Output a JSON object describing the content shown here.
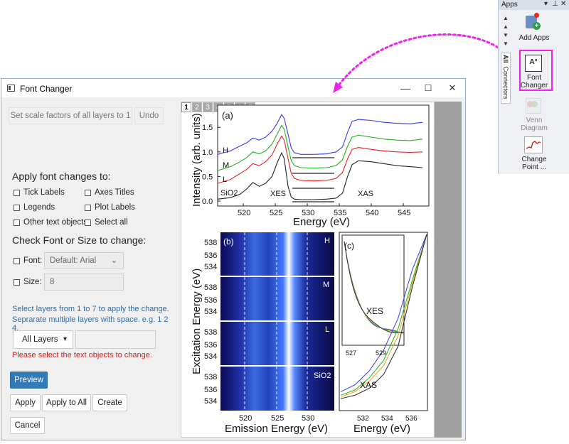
{
  "window": {
    "title": "Font Changer",
    "minimize": "—",
    "maximize": "☐",
    "close": "✕"
  },
  "top_buttons": {
    "scale": "Set scale factors of all layers to 1",
    "undo": "Undo"
  },
  "apply_section": {
    "heading": "Apply font changes to:",
    "options": [
      {
        "label": "Tick Labels",
        "checked": false
      },
      {
        "label": "Axes Titles",
        "checked": false
      },
      {
        "label": "Legends",
        "checked": false
      },
      {
        "label": "Plot Labels",
        "checked": false
      },
      {
        "label": "Other text objects",
        "checked": false
      },
      {
        "label": "Select all",
        "checked": false
      }
    ]
  },
  "check_section": {
    "heading": "Check Font or Size to change:",
    "font_label": "Font:",
    "font_value": "Default: Arial",
    "size_label": "Size:",
    "size_value": "8"
  },
  "layers_info": {
    "line1": "Select layers from 1 to 7 to apply the change.",
    "line2": "Seprarate multiple layers with space. e.g. 1 2 4."
  },
  "layer_select": {
    "value": "All Layers",
    "input_value": ""
  },
  "error_text": "Please select the text objects to change.",
  "buttons": {
    "preview": "Preview",
    "apply": "Apply",
    "apply_all": "Apply to All",
    "create": "Create",
    "cancel": "Cancel"
  },
  "layer_tabs": [
    "1",
    "2",
    "3",
    "4",
    "5",
    "6",
    "7"
  ],
  "apps_panel": {
    "title": "Apps",
    "tab_all": "All",
    "tab_connectors": "Connectors",
    "items": [
      {
        "label": "Add Apps"
      },
      {
        "label": "Font Changer"
      },
      {
        "label": "Venn Diagram"
      },
      {
        "label": "Change Point ..."
      }
    ]
  },
  "colors": {
    "highlight": "#ee22ee",
    "primary": "#337ab7",
    "error": "#d42020",
    "info": "#2e6da4"
  },
  "chart_data": [
    {
      "type": "line",
      "panel": "(a)",
      "xlabel": "Energy (eV)",
      "ylabel": "Intensity (arb. units)",
      "xlim": [
        516,
        549
      ],
      "ylim": [
        -0.1,
        1.95
      ],
      "xticks": [
        "520",
        "525",
        "530",
        "535",
        "540",
        "545"
      ],
      "yticks": [
        "0.0",
        "0.5",
        "1.0",
        "1.5"
      ],
      "annotations": [
        "H",
        "M",
        "L",
        "SiO2",
        "XES",
        "XAS"
      ],
      "series": [
        {
          "label": "H",
          "color": "#3a3aee",
          "x": [
            516,
            518,
            519.5,
            520.5,
            521.5,
            522.5,
            523.5,
            524.5,
            525.3,
            526,
            526.4,
            527,
            527.5,
            528,
            529,
            531,
            533,
            534.5,
            535.5,
            536.3,
            537,
            538,
            540,
            542,
            544,
            546,
            548
          ],
          "y": [
            0.95,
            1.02,
            1.12,
            1.18,
            1.28,
            1.24,
            1.3,
            1.42,
            1.58,
            1.76,
            1.68,
            1.36,
            1.08,
            0.98,
            0.95,
            0.95,
            0.96,
            1.0,
            1.1,
            1.4,
            1.62,
            1.66,
            1.64,
            1.6,
            1.58,
            1.57,
            1.6
          ]
        },
        {
          "label": "M",
          "color": "#1fb31f",
          "x": [
            516,
            518,
            519.5,
            520.5,
            521.5,
            522.5,
            523.5,
            524.5,
            525.3,
            526,
            526.4,
            527,
            527.5,
            528,
            529,
            531,
            533,
            534.5,
            535.5,
            536.3,
            537,
            538,
            540,
            542,
            544,
            546,
            548
          ],
          "y": [
            0.62,
            0.7,
            0.8,
            0.88,
            1.0,
            0.96,
            1.02,
            1.16,
            1.36,
            1.54,
            1.46,
            1.1,
            0.82,
            0.72,
            0.68,
            0.67,
            0.68,
            0.72,
            0.84,
            1.12,
            1.3,
            1.34,
            1.3,
            1.26,
            1.24,
            1.23,
            1.26
          ]
        },
        {
          "label": "L",
          "color": "#e82020",
          "x": [
            516,
            518,
            519.5,
            520.5,
            521.5,
            522.5,
            523.5,
            524.5,
            525.3,
            526,
            526.4,
            527,
            527.5,
            528,
            529,
            531,
            533,
            534.5,
            535.5,
            536.3,
            537,
            538,
            540,
            542,
            544,
            546,
            548
          ],
          "y": [
            0.36,
            0.44,
            0.56,
            0.64,
            0.76,
            0.72,
            0.8,
            0.94,
            1.16,
            1.32,
            1.24,
            0.86,
            0.56,
            0.46,
            0.42,
            0.41,
            0.42,
            0.46,
            0.58,
            0.86,
            1.05,
            1.09,
            1.05,
            1.02,
            1.0,
            0.99,
            1.0
          ]
        },
        {
          "label": "SiO2",
          "color": "#222222",
          "x": [
            516,
            518,
            519.5,
            520.5,
            521.5,
            522.5,
            523.5,
            524.5,
            525.3,
            526,
            526.4,
            527,
            527.5,
            528,
            529,
            531,
            533,
            534.5,
            535.5,
            536.3,
            537,
            538,
            540,
            542,
            544,
            546,
            548
          ],
          "y": [
            0.04,
            0.07,
            0.14,
            0.24,
            0.38,
            0.3,
            0.36,
            0.5,
            0.78,
            0.98,
            0.86,
            0.3,
            0.08,
            0.04,
            0.03,
            0.03,
            0.04,
            0.06,
            0.16,
            0.5,
            0.74,
            0.82,
            0.8,
            0.76,
            0.72,
            0.7,
            0.68
          ]
        }
      ]
    },
    {
      "type": "heatmap",
      "panel": "(b)",
      "xlabel": "Emission Energy (eV)",
      "ylabel": "Excitation Energy (eV)",
      "xticks": [
        "520",
        "525",
        "530"
      ],
      "yticks": [
        "534",
        "536",
        "538"
      ],
      "subpanels": [
        "H",
        "M",
        "L",
        "SiO2"
      ]
    },
    {
      "type": "line",
      "panel": "(c)",
      "xlabel": "Energy (eV)",
      "xticks": [
        "532",
        "534",
        "536"
      ],
      "inset_label": "XES",
      "inset_xticks": [
        "527",
        "529"
      ],
      "main_label": "XAS",
      "series": [
        {
          "name": "H",
          "color": "#3a3aee",
          "values": [
            0.1,
            0.14,
            0.22,
            0.34,
            0.52,
            0.8,
            1.0
          ]
        },
        {
          "name": "M",
          "color": "#1fb31f",
          "values": [
            0.08,
            0.11,
            0.18,
            0.28,
            0.46,
            0.74,
            1.0
          ]
        },
        {
          "name": "L",
          "color": "#e8a020",
          "values": [
            0.07,
            0.1,
            0.16,
            0.25,
            0.42,
            0.72,
            1.0
          ]
        },
        {
          "name": "SiO2",
          "color": "#222222",
          "values": [
            0.06,
            0.08,
            0.12,
            0.2,
            0.36,
            0.7,
            1.0
          ]
        }
      ]
    }
  ]
}
